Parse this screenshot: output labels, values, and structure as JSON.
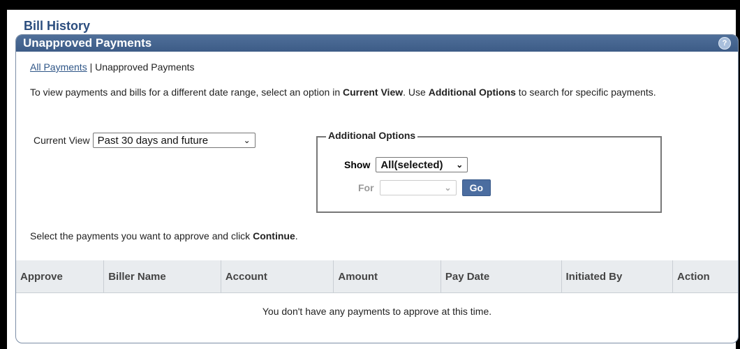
{
  "page": {
    "title": "Bill History"
  },
  "panel": {
    "title": "Unapproved Payments",
    "help_icon": "?"
  },
  "links": {
    "all_payments": "All Payments",
    "separator": "|",
    "current": "Unapproved Payments"
  },
  "instructions": {
    "part1": "To view payments and bills for a different date range, select an option in ",
    "bold1": "Current View",
    "part2": ". Use ",
    "bold2": "Additional Options",
    "part3": " to search for specific payments."
  },
  "current_view": {
    "label": "Current View",
    "value": "Past 30 days and future"
  },
  "additional_options": {
    "legend": "Additional Options",
    "show_label": "Show",
    "show_value": "All(selected)",
    "for_label": "For",
    "for_value": "",
    "go_label": "Go"
  },
  "prompt": {
    "text": "Select the payments you want to approve and click ",
    "bold": "Continue",
    "end": "."
  },
  "table": {
    "headers": [
      "Approve",
      "Biller Name",
      "Account",
      "Amount",
      "Pay Date",
      "Initiated By",
      "Action"
    ],
    "empty_message": "You don't have any payments to approve at this time."
  }
}
